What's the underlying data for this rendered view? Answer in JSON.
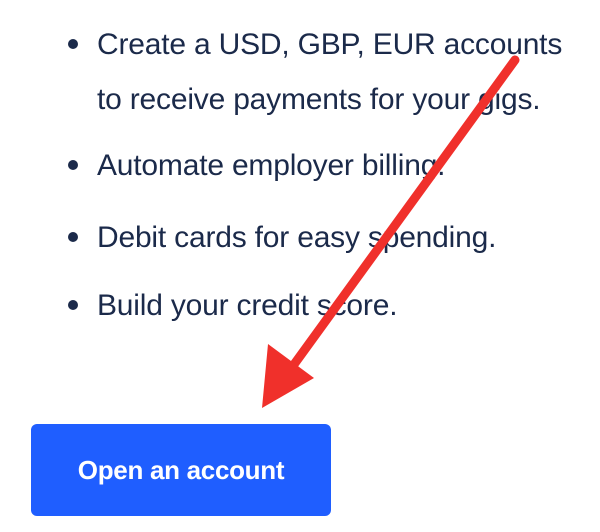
{
  "features": {
    "items": [
      {
        "text": "Create a USD, GBP, EUR accounts to  receive payments for your gigs."
      },
      {
        "text": "Automate employer billing."
      },
      {
        "text": "Debit cards for easy spending."
      },
      {
        "text": "Build your credit score."
      }
    ]
  },
  "cta": {
    "label": "Open an account",
    "background_color": "#1f5eff",
    "text_color": "#ffffff"
  },
  "annotation": {
    "arrow_color": "#f0302b",
    "arrow_icon": "red-arrow-annotation-icon"
  },
  "colors": {
    "text": "#1b2a4a",
    "background": "#ffffff"
  }
}
